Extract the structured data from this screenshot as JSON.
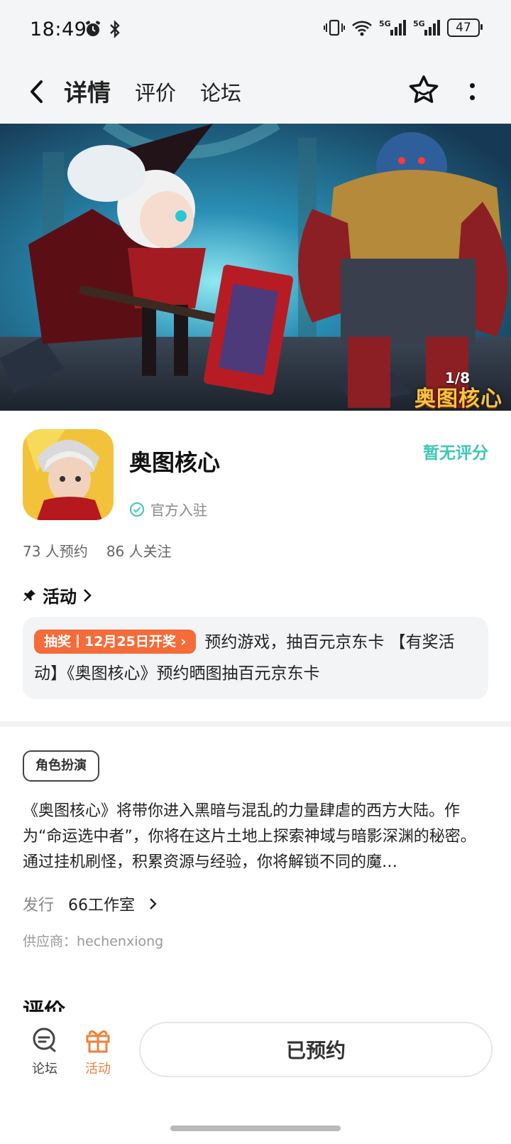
{
  "status_bar": {
    "time": "18:49",
    "battery": "47",
    "icons": [
      "alarm-icon",
      "bluetooth-icon",
      "vibrate-icon",
      "wifi-icon",
      "signal-5g-icon",
      "signal-5g-icon"
    ]
  },
  "nav": {
    "tabs": [
      {
        "label": "详情",
        "active": true
      },
      {
        "label": "评价",
        "active": false
      },
      {
        "label": "论坛",
        "active": false
      }
    ],
    "accent": "#2fd3c3"
  },
  "banner": {
    "counter": "1/8",
    "logo_text": "奥图核心"
  },
  "game": {
    "title": "奥图核心",
    "verified": "官方入驻",
    "rating": "暂无评分",
    "reservations": "73 人预约",
    "followers": "86 人关注"
  },
  "activity": {
    "heading": "活动",
    "badge": "抽奖丨12月25日开奖",
    "text": "预约游戏，抽百元京东卡 【有奖活动】《奥图核心》预约晒图抽百元京东卡",
    "badge_color": "#f56b3a"
  },
  "details": {
    "genre": "角色扮演",
    "description": "《奥图核心》将带你进入黑暗与混乱的力量肆虐的西方大陆。作为“命运选中者”，你将在这片土地上探索神域与暗影深渊的秘密。通过挂机刷怪，积累资源与经验，你将解锁不同的魔…",
    "publisher_label": "发行",
    "publisher_name": "66工作室",
    "supplier": "供应商：hechenxiong",
    "reviews_heading": "评价"
  },
  "bottom_bar": {
    "forum_label": "论坛",
    "activity_label": "活动",
    "reserve_label": "已预约",
    "activity_color": "#f0813a"
  }
}
